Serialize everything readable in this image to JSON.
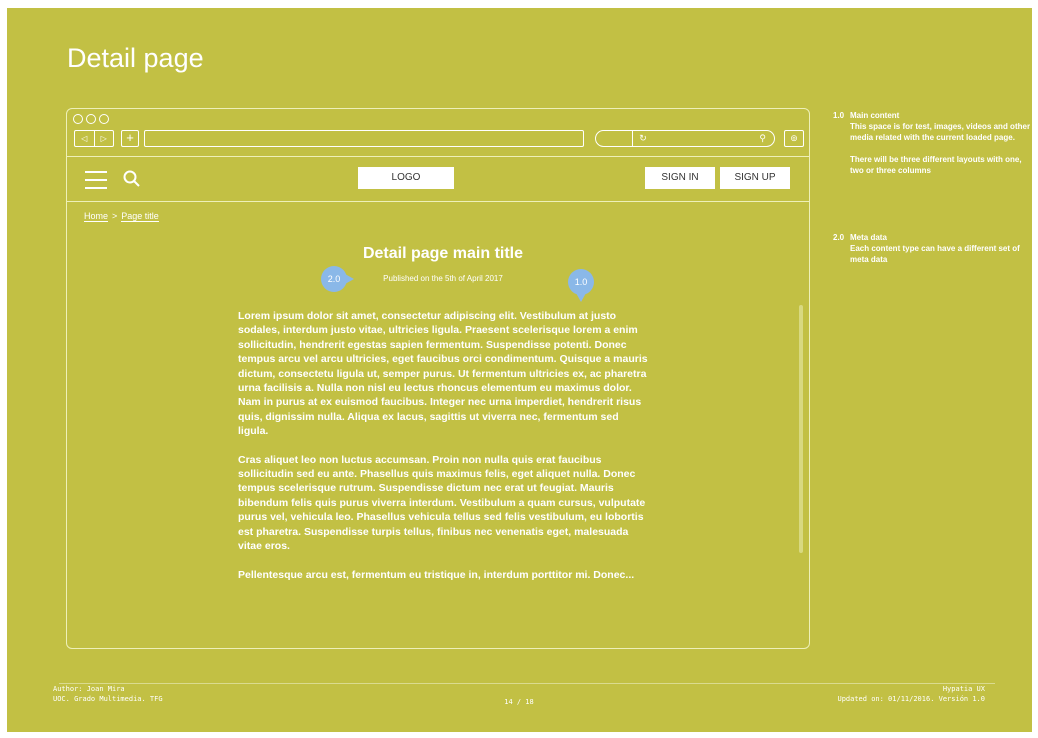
{
  "page": {
    "title": "Detail page"
  },
  "browser": {
    "toolbar": {
      "back_glyph": "◁",
      "forward_glyph": "▷",
      "new_tab_glyph": "+",
      "reload_glyph": "↻",
      "search_glyph": "⚲",
      "download_glyph": "⊚"
    }
  },
  "site_header": {
    "logo": "LOGO",
    "sign_in": "SIGN IN",
    "sign_up": "SIGN UP"
  },
  "breadcrumb": {
    "home": "Home",
    "separator": ">",
    "current": "Page title"
  },
  "main": {
    "title": "Detail page main title",
    "published": "Published on the 5th of April 2017",
    "paragraphs": [
      "Lorem ipsum dolor sit amet, consectetur adipiscing elit. Vestibulum at justo sodales, interdum justo vitae, ultricies ligula. Praesent scelerisque lorem a enim sollicitudin, hendrerit egestas sapien fermentum. Suspendisse potenti. Donec tempus arcu vel arcu ultricies, eget faucibus orci condimentum. Quisque a mauris dictum, consectetu ligula ut, semper purus. Ut fermentum ultricies ex, ac pharetra urna facilisis a. Nulla non nisl eu lectus rhoncus elementum eu maximus dolor. Nam in purus at ex euismod faucibus. Integer nec urna imperdiet, hendrerit risus quis, dignissim nulla. Aliqua ex lacus, sagittis ut viverra nec, fermentum sed ligula.",
      "Cras aliquet leo non luctus accumsan. Proin non nulla quis erat faucibus sollicitudin sed eu ante. Phasellus quis maximus felis, eget aliquet nulla. Donec tempus scelerisque rutrum. Suspendisse dictum nec erat ut feugiat. Mauris bibendum felis quis purus viverra interdum. Vestibulum a quam cursus, vulputate purus vel, vehicula leo. Phasellus vehicula tellus sed felis vestibulum, eu lobortis est pharetra. Suspendisse turpis tellus, finibus nec venenatis eget, malesuada vitae eros.",
      "Pellentesque arcu est, fermentum eu tristique in, interdum porttitor mi. Donec..."
    ]
  },
  "markers": {
    "meta": "2.0",
    "main": "1.0"
  },
  "annotations": [
    {
      "number": "1.0",
      "title": "Main content",
      "lines": [
        "This space is for test, images, videos and other media related with the current loaded page.",
        "There will be three different layouts with one, two or three columns"
      ]
    },
    {
      "number": "2.0",
      "title": "Meta data",
      "lines": [
        "Each content type can have a different set of meta data"
      ]
    }
  ],
  "footer": {
    "author": "Author: Joan Mira",
    "course": "UOC. Grado Multimedia. TFG",
    "page": "14 / 18",
    "brand": "Hypatia UX",
    "updated": "Updated on: 01/11/2016. Versión 1.0"
  },
  "colors": {
    "background": "#c2c044",
    "marker": "#8ab8e8",
    "text": "#ffffff",
    "button_bg": "#ffffff"
  }
}
